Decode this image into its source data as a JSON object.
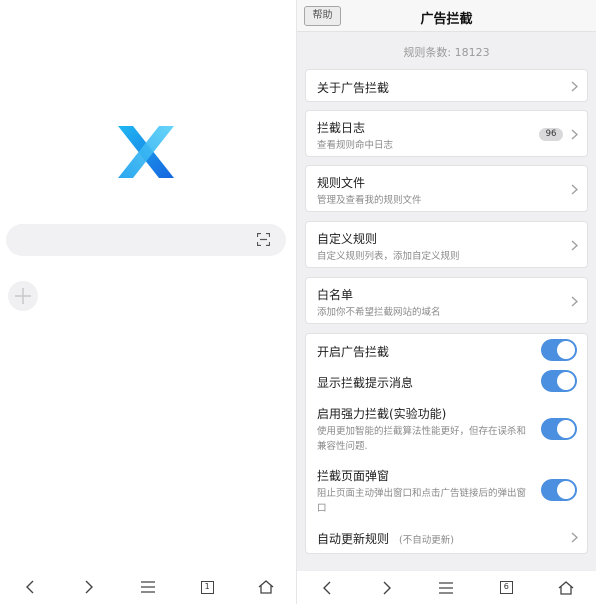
{
  "left_panel": {
    "logo": "x-browser-logo",
    "search": {
      "placeholder": "",
      "scan_icon": "scan-icon"
    },
    "add_button_icon": "plus-icon",
    "tab_count": "1"
  },
  "right_panel": {
    "header": {
      "help_label": "帮助",
      "title": "广告拦截"
    },
    "rule_count_label": "规则条数: 18123",
    "items": [
      {
        "title": "关于广告拦截",
        "subtitle": ""
      },
      {
        "title": "拦截日志",
        "subtitle": "查看规则命中日志",
        "badge": "96"
      },
      {
        "title": "规则文件",
        "subtitle": "管理及查看我的规则文件"
      },
      {
        "title": "自定义规则",
        "subtitle": "自定义规则列表，添加自定义规则"
      },
      {
        "title": "白名单",
        "subtitle": "添加你不希望拦截网站的域名"
      }
    ],
    "settings": [
      {
        "title": "开启广告拦截",
        "enabled": true
      },
      {
        "title": "显示拦截提示消息",
        "enabled": true
      },
      {
        "title": "启用强力拦截(实验功能)",
        "desc_line1": "使用更加智能的拦截算法性能更好，但存在误杀和",
        "desc_line2": "兼容性问题.",
        "enabled": true
      },
      {
        "title": "拦截页面弹窗",
        "desc_line1": "阻止页面主动弹出窗口和点击广告链接后的弹出窗",
        "desc_line2": "口",
        "enabled": true
      },
      {
        "title": "自动更新规则",
        "note": "(不自动更新)"
      }
    ],
    "tab_count": "6"
  },
  "colors": {
    "accent": "#4a8fe0",
    "panel_bg": "#f0f0f2"
  }
}
